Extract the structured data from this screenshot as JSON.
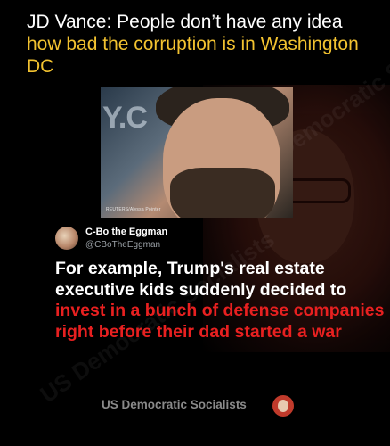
{
  "headline": {
    "prefix": "JD Vance: People don’t have any idea ",
    "highlight": "how bad the corruption is in Washington DC"
  },
  "photo": {
    "background_text": "Y.C",
    "credit": "REUTERS/Alyssa Pointer"
  },
  "tweet": {
    "name": "C-Bo the Eggman",
    "handle": "@CBoTheEggman",
    "text_white": "For example, Trump's real estate executive kids suddenly decided to ",
    "text_red": "invest in a bunch of defense companies right before their dad started a war"
  },
  "footer": {
    "label": "US Democratic Socialists"
  },
  "watermark": "US Democratic Socialists",
  "colors": {
    "highlight": "#f2c230",
    "red_text": "#e82020",
    "background": "#000000"
  }
}
